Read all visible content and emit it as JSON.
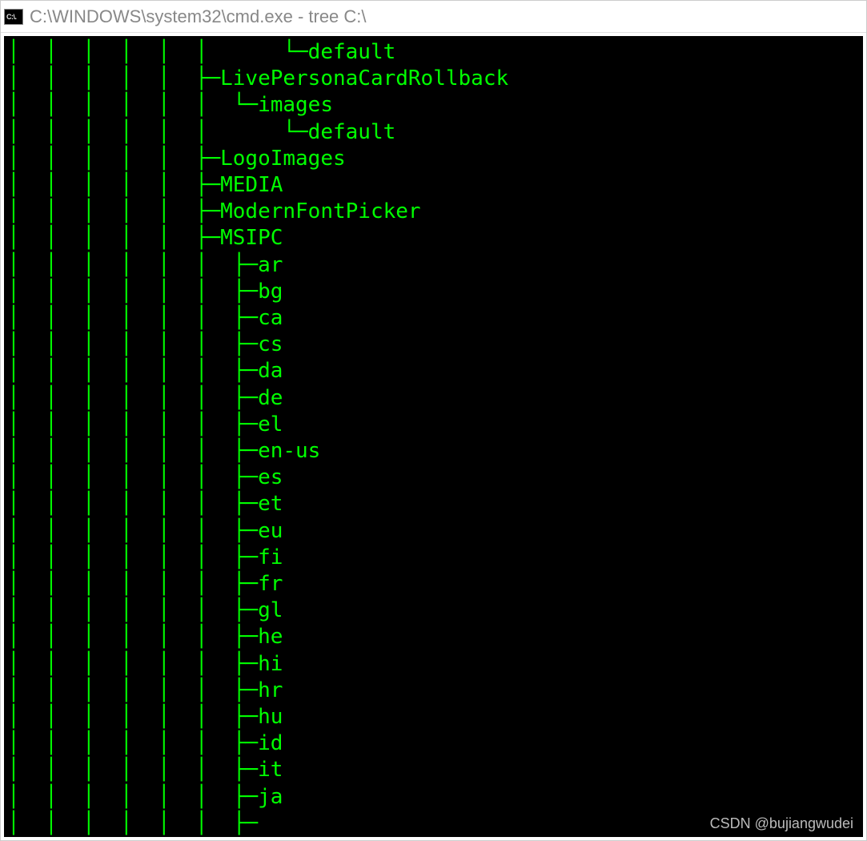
{
  "window": {
    "icon_label": "C:\\.",
    "title": "C:\\WINDOWS\\system32\\cmd.exe - tree  C:\\"
  },
  "tree_lines": [
    "│  │  │  │  │  │      └─default",
    "│  │  │  │  │  ├─LivePersonaCardRollback",
    "│  │  │  │  │  │  └─images",
    "│  │  │  │  │  │      └─default",
    "│  │  │  │  │  ├─LogoImages",
    "│  │  │  │  │  ├─MEDIA",
    "│  │  │  │  │  ├─ModernFontPicker",
    "│  │  │  │  │  ├─MSIPC",
    "│  │  │  │  │  │  ├─ar",
    "│  │  │  │  │  │  ├─bg",
    "│  │  │  │  │  │  ├─ca",
    "│  │  │  │  │  │  ├─cs",
    "│  │  │  │  │  │  ├─da",
    "│  │  │  │  │  │  ├─de",
    "│  │  │  │  │  │  ├─el",
    "│  │  │  │  │  │  ├─en-us",
    "│  │  │  │  │  │  ├─es",
    "│  │  │  │  │  │  ├─et",
    "│  │  │  │  │  │  ├─eu",
    "│  │  │  │  │  │  ├─fi",
    "│  │  │  │  │  │  ├─fr",
    "│  │  │  │  │  │  ├─gl",
    "│  │  │  │  │  │  ├─he",
    "│  │  │  │  │  │  ├─hi",
    "│  │  │  │  │  │  ├─hr",
    "│  │  │  │  │  │  ├─hu",
    "│  │  │  │  │  │  ├─id",
    "│  │  │  │  │  │  ├─it",
    "│  │  │  │  │  │  ├─ja",
    "│  │  │  │  │  │  ├─"
  ],
  "watermark": "CSDN @bujiangwudei"
}
